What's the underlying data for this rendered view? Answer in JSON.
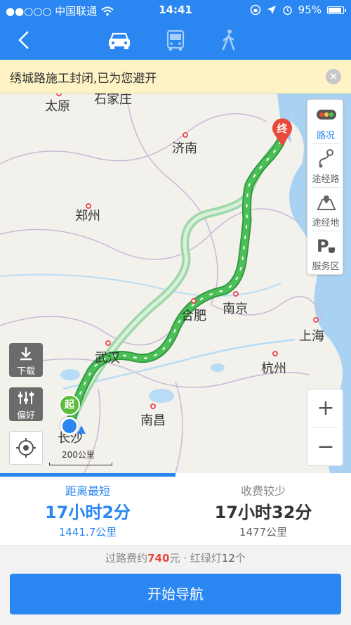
{
  "status_bar": {
    "carrier": "●●○○○ 中国联通",
    "time": "14:41",
    "battery_percent": "95%",
    "battery_level": 0.95
  },
  "header": {
    "back_icon": "chevron-left-icon",
    "modes": [
      {
        "name": "car",
        "icon": "car-icon",
        "active": true
      },
      {
        "name": "bus",
        "icon": "bus-icon",
        "active": false
      },
      {
        "name": "walk",
        "icon": "walking-person-icon",
        "active": false
      }
    ]
  },
  "notice": {
    "text": "绣城路施工封闭,已为您避开"
  },
  "map": {
    "cities": {
      "taiyuan": "太原",
      "shijiazhuang": "石家庄",
      "jinan": "济南",
      "zhengzhou": "郑州",
      "nanjing": "南京",
      "hefei": "合肥",
      "shanghai": "上海",
      "wuhan": "武汉",
      "hangzhou": "杭州",
      "nanchang": "南昌",
      "changsha": "长沙"
    },
    "start_marker": "起",
    "end_marker": "终",
    "scale_label": "200公里",
    "tools": {
      "traffic": "路况",
      "waypoint": "途经路",
      "via_place": "途经地",
      "service": "服务区"
    },
    "download_label": "下载",
    "preference_label": "偏好",
    "zoom_in": "+",
    "zoom_out": "−"
  },
  "routes": [
    {
      "label": "距离最短",
      "time": "17小时2分",
      "distance": "1441.7公里",
      "selected": true
    },
    {
      "label": "收费较少",
      "time": "17小时32分",
      "distance": "1477公里",
      "selected": false
    }
  ],
  "summary": {
    "toll_prefix": "过路费约",
    "toll_amount": "740",
    "toll_unit": "元",
    "separator": " · ",
    "lights_prefix": "红绿灯",
    "lights_count": "12",
    "lights_unit": "个"
  },
  "start_button": "开始导航",
  "colors": {
    "brand_blue": "#2a86f0",
    "route_green": "#3fb24c",
    "alt_route": "#9fd8a8",
    "notice_bg": "#fdf3c4",
    "toll_red": "#e64a3c"
  }
}
